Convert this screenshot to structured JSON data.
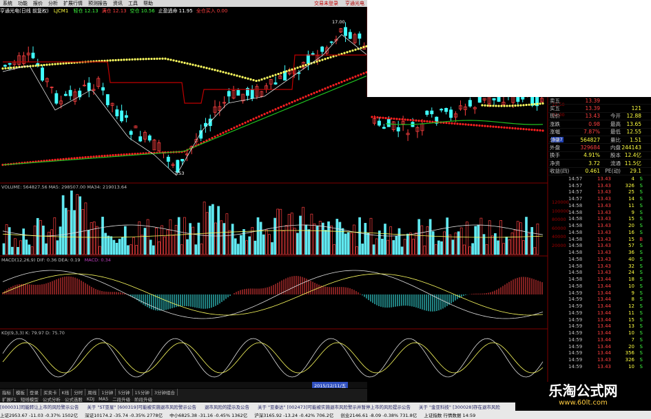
{
  "menu": {
    "items": [
      "系统",
      "功能",
      "报价",
      "分析",
      "扩展行情",
      "预测报告",
      "资讯",
      "工具",
      "帮助"
    ],
    "right_items": [
      "交易未登录",
      "亨通光电"
    ]
  },
  "chart_header": {
    "stock": "亨通光电(日线 前复权)",
    "indicator": "LJCM1",
    "fields": [
      {
        "label": "轻仓",
        "value": "12.13",
        "color": "#40ff40"
      },
      {
        "label": "满仓",
        "value": "12.13",
        "color": "#ff4040"
      },
      {
        "label": "空仓",
        "value": "10.56",
        "color": "#40ff40"
      },
      {
        "label": "止盈逃命",
        "value": "11.95",
        "color": "#ffffff"
      },
      {
        "label": "全仓买入",
        "value": "0.00",
        "color": "#ff4040"
      }
    ],
    "price_high_label": "17.00",
    "price_low_label": "7.53",
    "mid_label": "9.27",
    "right_scale": [
      "12.50",
      "12.00"
    ]
  },
  "volume_header": {
    "text": "VOLUME: 564827.56  MA5: 298507.00  MA34: 219013.64",
    "right_scale": [
      "120000",
      "100000",
      "80000",
      "60000",
      "40000",
      "20000"
    ]
  },
  "macd_header": {
    "text": "MACD(12,26,9)  DIF: 0.36  DEA: 0.19",
    "value_label": "MACD: 0.34"
  },
  "kdj_header": {
    "text": "KDJ(9,3,3)  K: 79.97  D: 75.70"
  },
  "date_label": "2015/12/11/五",
  "bottom_tabs": [
    "指标",
    "模板",
    "登录",
    "买卖卡",
    "K线",
    "分时",
    "周线",
    "1分钟",
    "5分钟",
    "15分钟",
    "3分钟组合"
  ],
  "bottom_tabs2": [
    "扩展F1",
    "短线模型",
    "公式分析",
    "公式选股",
    "KDJ",
    "MA5",
    "二段升级",
    "阶段升级"
  ],
  "quote_panel": {
    "rows": [
      {
        "k": "卖五",
        "v": "13.39",
        "vcolor": "red",
        "k2": "",
        "v2": ""
      },
      {
        "k": "买五",
        "v": "13.39",
        "vcolor": "red",
        "k2": "",
        "v2": "121"
      },
      {
        "k": "现价",
        "v": "13.43",
        "vcolor": "red",
        "k2": "今开",
        "v2": "12.88"
      },
      {
        "k": "涨跌",
        "v": "0.98",
        "vcolor": "red",
        "k2": "最高",
        "v2": "13.65"
      },
      {
        "k": "涨幅",
        "v": "7.87%",
        "vcolor": "red",
        "k2": "最低",
        "v2": "12.55"
      },
      {
        "k": "总量",
        "v": "564827",
        "vcolor": "yel",
        "k2": "量比",
        "v2": "1.51"
      },
      {
        "k": "外盘",
        "v": "329684",
        "vcolor": "red",
        "k2": "内盘",
        "v2": "244143"
      },
      {
        "k": "换手",
        "v": "4.91%",
        "vcolor": "yel",
        "k2": "股本",
        "v2": "12.4亿"
      },
      {
        "k": "净资",
        "v": "3.72",
        "vcolor": "yel",
        "k2": "流通",
        "v2": "11.5亿"
      },
      {
        "k": "收益(四)",
        "v": "0.461",
        "vcolor": "yel",
        "k2": "PE(动)",
        "v2": "29.1"
      }
    ],
    "ticks": [
      {
        "t": "14:57",
        "p": "13.43",
        "v": "4",
        "bs": "S"
      },
      {
        "t": "14:57",
        "p": "13.43",
        "v": "326",
        "bs": "S"
      },
      {
        "t": "14:57",
        "p": "13.43",
        "v": "25",
        "bs": "S"
      },
      {
        "t": "14:57",
        "p": "13.43",
        "v": "14",
        "bs": "S"
      },
      {
        "t": "14:58",
        "p": "13.43",
        "v": "11",
        "bs": "S"
      },
      {
        "t": "14:58",
        "p": "13.43",
        "v": "9",
        "bs": "S"
      },
      {
        "t": "14:58",
        "p": "13.43",
        "v": "15",
        "bs": "S"
      },
      {
        "t": "14:58",
        "p": "13.43",
        "v": "20",
        "bs": "S"
      },
      {
        "t": "14:58",
        "p": "13.43",
        "v": "16",
        "bs": "S"
      },
      {
        "t": "14:58",
        "p": "13.43",
        "v": "15",
        "bs": "B"
      },
      {
        "t": "14:58",
        "p": "13.43",
        "v": "57",
        "bs": "S"
      },
      {
        "t": "14:58",
        "p": "13.43",
        "v": "36",
        "bs": "S"
      },
      {
        "t": "14:58",
        "p": "13.43",
        "v": "40",
        "bs": "S"
      },
      {
        "t": "14:58",
        "p": "13.43",
        "v": "32",
        "bs": "S"
      },
      {
        "t": "14:58",
        "p": "13.43",
        "v": "24",
        "bs": "S"
      },
      {
        "t": "14:58",
        "p": "13.44",
        "v": "18",
        "bs": "S"
      },
      {
        "t": "14:58",
        "p": "13.44",
        "v": "10",
        "bs": "S"
      },
      {
        "t": "14:59",
        "p": "13.44",
        "v": "9",
        "bs": "S"
      },
      {
        "t": "14:59",
        "p": "13.44",
        "v": "8",
        "bs": "S"
      },
      {
        "t": "14:59",
        "p": "13.44",
        "v": "12",
        "bs": "S"
      },
      {
        "t": "14:59",
        "p": "13.44",
        "v": "11",
        "bs": "S"
      },
      {
        "t": "14:59",
        "p": "13.44",
        "v": "15",
        "bs": "S"
      },
      {
        "t": "14:59",
        "p": "13.44",
        "v": "13",
        "bs": "S"
      },
      {
        "t": "14:59",
        "p": "13.44",
        "v": "10",
        "bs": "S"
      },
      {
        "t": "14:59",
        "p": "13.44",
        "v": "7",
        "bs": "S"
      },
      {
        "t": "14:59",
        "p": "13.44",
        "v": "20",
        "bs": "S"
      },
      {
        "t": "14:59",
        "p": "13.44",
        "v": "356",
        "bs": "S"
      },
      {
        "t": "14:59",
        "p": "13.43",
        "v": "326",
        "bs": "S"
      },
      {
        "t": "14:59",
        "p": "13.43",
        "v": "10",
        "bs": "S"
      }
    ]
  },
  "ticker": [
    "[000031]司能转让上市的风险警示公告",
    "关于 \"ST亚星\" [600319]可能被实施退市风险警示公告",
    "退市风险的提示及公告",
    "关于 \"亚泰达\" [002473]可能被实施退市风险警示并暂停上市的风险提示公告",
    "关于 \"金亚科技\" [300028]存在退市风险"
  ],
  "status": [
    "上证2953.67 -11.03 -0.37% 1502亿",
    "深证10174.2 -35.74 -0.35% 2778亿",
    "中小6825.38 -31.16 -0.45% 1362亿",
    "沪深3165.92 -13.24 -0.42% 706.2亿",
    "创业2146.61 -8.09 -0.38% 731.8亿",
    "上证指数 行情数据 14:59"
  ],
  "watermark": {
    "title": "乐淘公式网",
    "url": "www.60lt.com"
  },
  "colors": {
    "up": "#ff4040",
    "down": "#40ffff",
    "yellow_dots": "#ffff60",
    "red_dots": "#ff2020",
    "ma_green": "#20c020",
    "ma_red": "#c00000",
    "volume_up": "#ff4040",
    "volume_down": "#60e8f0"
  }
}
